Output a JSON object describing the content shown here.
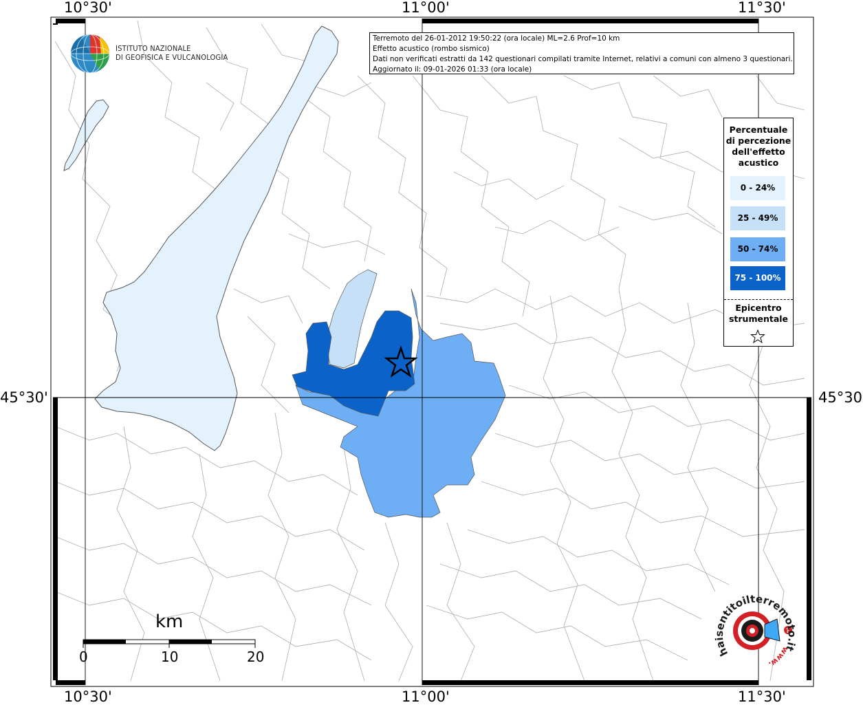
{
  "coordinates": {
    "lon_top": [
      "10°30'",
      "11°00'",
      "11°30'"
    ],
    "lon_bottom": [
      "10°30'",
      "11°00'",
      "11°30'"
    ],
    "lat_left": "45°30'",
    "lat_right": "45°30'"
  },
  "logo": {
    "line1": "ISTITUTO NAZIONALE",
    "line2": "DI GEOFISICA E VULCANOLOGIA"
  },
  "info": {
    "line1": "Terremoto del 26-01-2012 19:50:22 (ora locale) ML=2.6 Prof=10 km",
    "line2": "Effetto acustico (rombo sismico)",
    "line3": "Dati non verificati estratti da 142 questionari compilati tramite Internet, relativi a comuni con almeno 3 questionari.",
    "line4": "Aggiornato il: 09-01-2026 01:33 (ora locale)"
  },
  "legend": {
    "title_lines": [
      "Percentuale",
      "di percezione",
      "dell'effetto",
      "acustico"
    ],
    "items": [
      {
        "label": "0 - 24%",
        "color": "#e3f2fd",
        "text_color": "#000000"
      },
      {
        "label": "25 - 49%",
        "color": "#c6e0f7",
        "text_color": "#000000"
      },
      {
        "label": "50 - 74%",
        "color": "#6daef5",
        "text_color": "#000000"
      },
      {
        "label": "75 - 100%",
        "color": "#0b63c9",
        "text_color": "#ffffff"
      }
    ],
    "epicenter_lines": [
      "Epicentro",
      "strumentale"
    ],
    "epicenter_symbol": "star-icon"
  },
  "scale": {
    "title": "km",
    "labels": [
      "0",
      "10",
      "20"
    ]
  },
  "badge": {
    "text": "haisentitoilterremoto.it",
    "www": "www.",
    "colors": {
      "red": "#d32027",
      "blue": "#3fa9f5"
    }
  },
  "colors": {
    "lake": "#e3f2fd",
    "band1": "#c6e0f7",
    "band2": "#6daef5",
    "band3": "#0b63c9",
    "boundary": "#b4b4b4"
  }
}
